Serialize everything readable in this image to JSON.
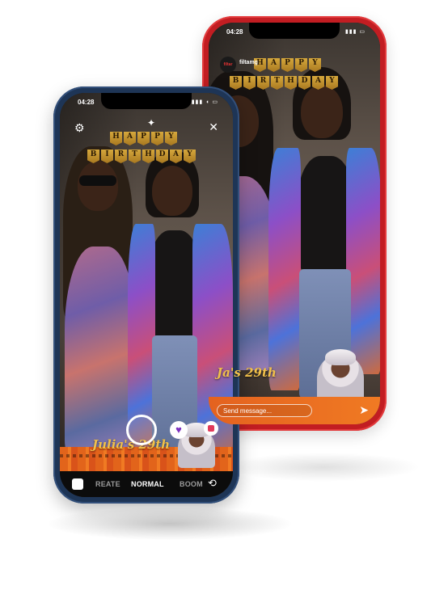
{
  "front_phone": {
    "status_time": "04:28",
    "status_icons": "▮▮▮ ◖ ▭",
    "banner_row1": [
      "H",
      "A",
      "P",
      "P",
      "Y"
    ],
    "banner_row2": [
      "B",
      "I",
      "R",
      "T",
      "H",
      "D",
      "A",
      "Y"
    ],
    "caption": "Julia's 29th",
    "modes": [
      "REATE",
      "NORMAL",
      "BOOM"
    ],
    "active_mode": "NORMAL",
    "icons": {
      "settings": "⚙",
      "sparkle": "✦",
      "close": "✕",
      "heart": "♥",
      "flip": "⟲"
    }
  },
  "back_phone": {
    "status_time": "04:28",
    "status_icons": "▮▮▮ ▭",
    "account_name": "filtamg",
    "avatar_text": "filtar",
    "banner_row1": [
      "H",
      "A",
      "P",
      "P",
      "Y"
    ],
    "banner_row2": [
      "B",
      "I",
      "R",
      "T",
      "H",
      "D",
      "A",
      "Y"
    ],
    "caption": "Ja's 29th",
    "message_placeholder": "Send message...",
    "icons": {
      "send": "➤"
    }
  },
  "colors": {
    "back_frame": "#c21d22",
    "front_frame": "#1e3556",
    "kente_orange": "#f07a23",
    "banner_gold": "#d6a83c",
    "heart_purple": "#7d2fbf"
  }
}
